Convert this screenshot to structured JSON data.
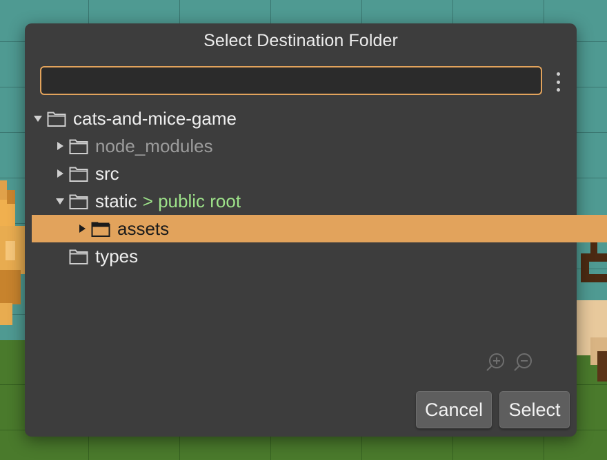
{
  "dialog": {
    "title": "Select Destination Folder",
    "search": {
      "value": "",
      "placeholder": ""
    },
    "menu_icon": "kebab-menu-icon",
    "accent_color": "#e2a35c",
    "tag_color": "#9ee38a"
  },
  "tree": {
    "items": [
      {
        "label": "cats-and-mice-game",
        "depth": 0,
        "expanded": true,
        "has_children": true,
        "icon": "folder-icon"
      },
      {
        "label": "node_modules",
        "depth": 1,
        "expanded": false,
        "has_children": true,
        "dimmed": true,
        "icon": "folder-icon"
      },
      {
        "label": "src",
        "depth": 1,
        "expanded": false,
        "has_children": true,
        "icon": "folder-icon"
      },
      {
        "label": "static",
        "tag": "> public root",
        "depth": 1,
        "expanded": true,
        "has_children": true,
        "icon": "folder-icon"
      },
      {
        "label": "assets",
        "depth": 2,
        "expanded": false,
        "has_children": true,
        "selected": true,
        "icon": "folder-icon"
      },
      {
        "label": "types",
        "depth": 1,
        "expanded": false,
        "has_children": false,
        "icon": "folder-icon"
      }
    ]
  },
  "zoom": {
    "in_icon": "zoom-in-icon",
    "out_icon": "zoom-out-icon"
  },
  "buttons": {
    "cancel": "Cancel",
    "select": "Select"
  }
}
